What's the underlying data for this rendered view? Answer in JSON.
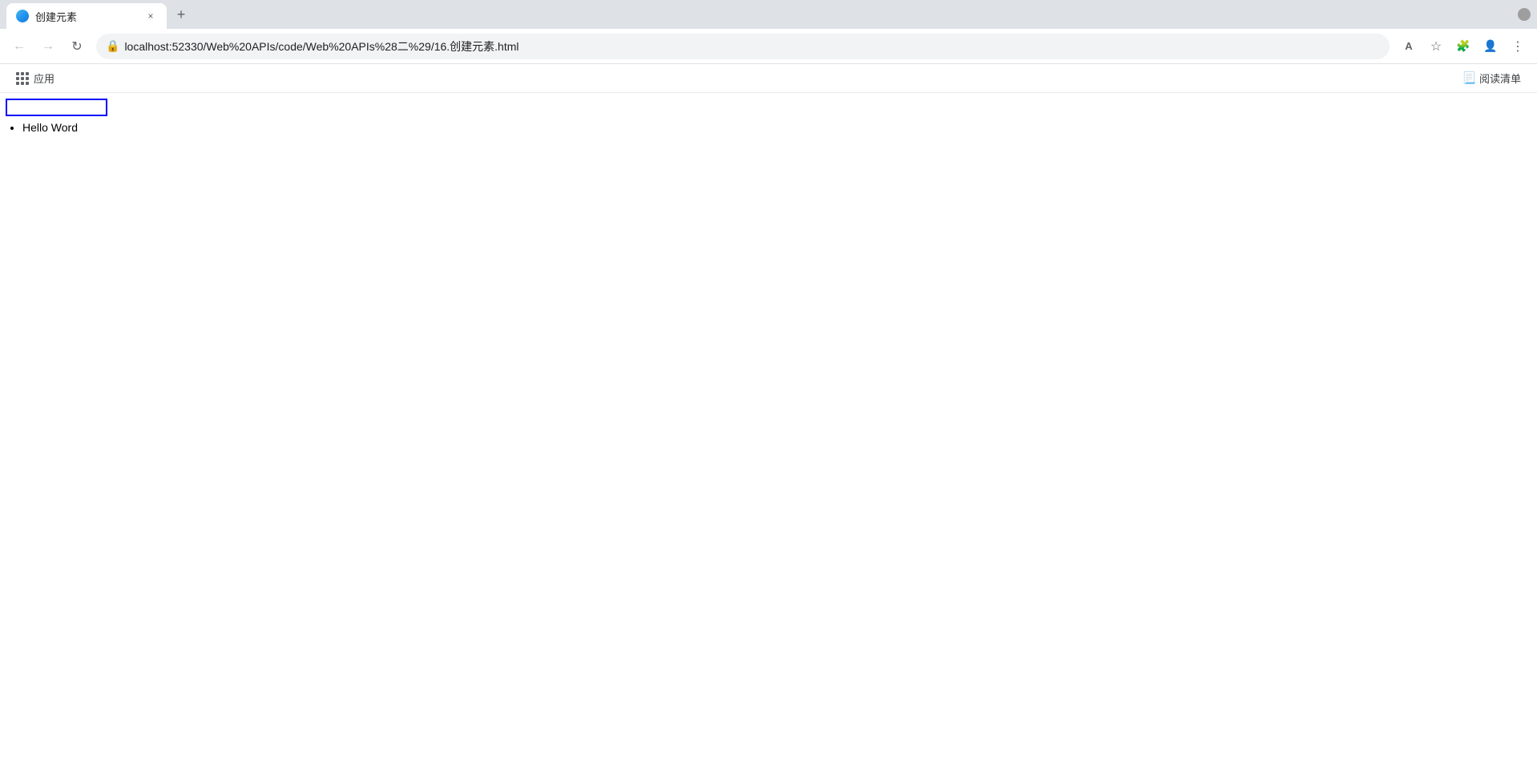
{
  "browser": {
    "tab": {
      "favicon_alt": "tab-favicon",
      "title": "创建元素",
      "close_label": "×",
      "new_tab_label": "+"
    },
    "nav": {
      "back_label": "←",
      "forward_label": "→",
      "reload_label": "↻",
      "url": "localhost:52330/Web%20APIs/code/Web%20APIs%28二%29/16.创建元素.html",
      "translate_label": "A",
      "bookmark_label": "☆",
      "extensions_label": "🧩",
      "profile_label": "👤",
      "menu_label": "⋮"
    },
    "bookmarks": {
      "apps_label": "应用",
      "reader_mode_label": "阅读清单"
    }
  },
  "page": {
    "input_value": "",
    "list_item": "Hello Word"
  }
}
